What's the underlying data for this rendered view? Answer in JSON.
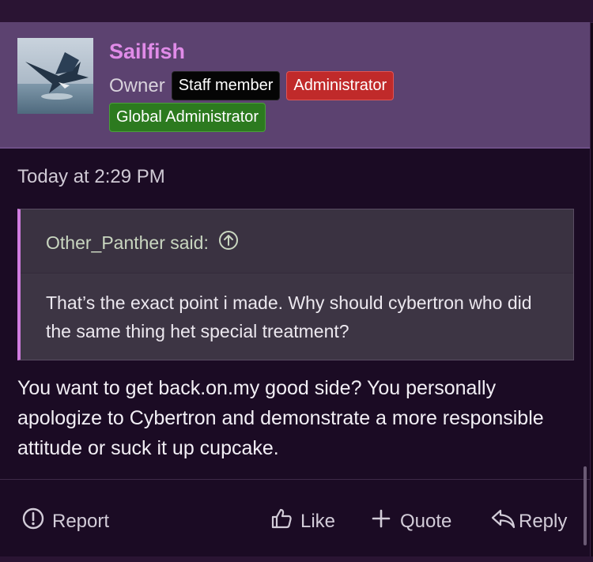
{
  "post": {
    "author": {
      "username": "Sailfish",
      "title": "Owner",
      "badges": {
        "staff": "Staff member",
        "admin": "Administrator",
        "global_admin": "Global Administrator"
      }
    },
    "timestamp": "Today at 2:29 PM",
    "quote": {
      "author_line": "Other_Panther said:",
      "body": "That’s the exact point i made. Why should cybertron who did the same thing het special treatment?"
    },
    "message": "You want to get back.on.my good side? You personally apologize to Cybertron and demonstrate a more responsible attitude or suck it up cupcake.",
    "actions": {
      "report": "Report",
      "like": "Like",
      "quote": "Quote",
      "reply": "Reply"
    }
  },
  "colors": {
    "header_bg": "#5c4270",
    "username": "#e08be8",
    "badge_staff": "#050505",
    "badge_admin": "#c02a2a",
    "badge_global_admin": "#2c7a1f",
    "quote_accent": "#d07ce0",
    "page_bg": "#1b0b24"
  },
  "icons": {
    "avatar": "sailfish-photo",
    "quote_jump": "arrow-up-circle-icon",
    "report": "exclamation-circle-icon",
    "like": "thumbs-up-icon",
    "quote": "plus-icon",
    "reply": "reply-arrow-icon"
  }
}
